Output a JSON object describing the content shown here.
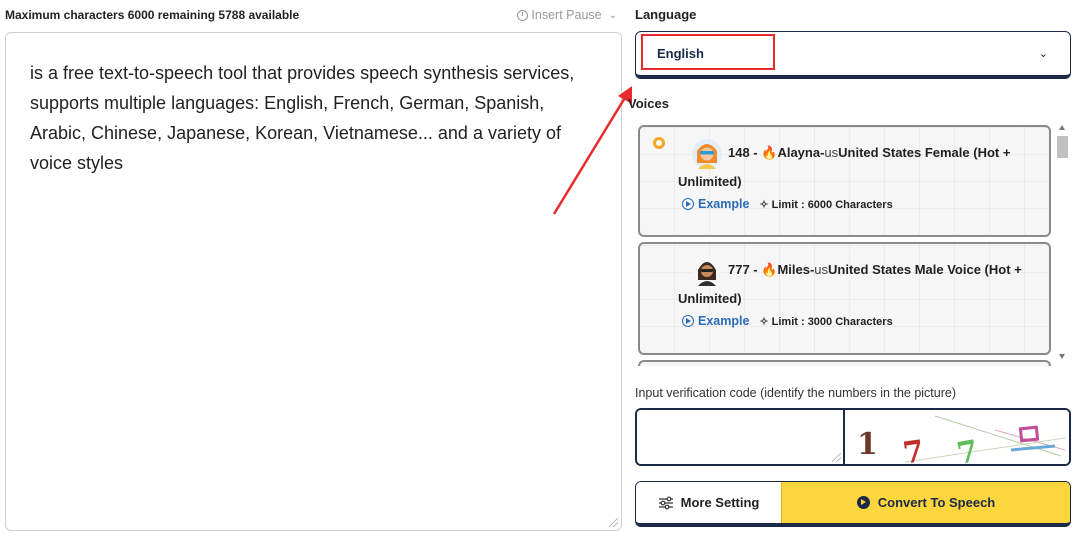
{
  "editor": {
    "char_info": "Maximum characters 6000 remaining 5788 available",
    "insert_pause_label": "Insert Pause",
    "text": "is a free text-to-speech tool that provides speech synthesis services, supports multiple languages: English, French, German, Spanish, Arabic, Chinese, Japanese, Korean, Vietnamese... and a variety of voice styles"
  },
  "language": {
    "label": "Language",
    "selected": "English"
  },
  "voices": {
    "label": "Voices",
    "items": [
      {
        "number": "148 - ",
        "name": "Alayna-",
        "locale": "us",
        "desc": "United States Female (Hot +",
        "desc2": "Unlimited)",
        "example_label": "Example",
        "limit": "Limit : 6000 Characters",
        "selected": true
      },
      {
        "number": "777 - ",
        "name": "Miles-",
        "locale": "us",
        "desc": "United States Male Voice (Hot +",
        "desc2": "Unlimited)",
        "example_label": "Example",
        "limit": "Limit : 3000 Characters",
        "selected": false
      }
    ]
  },
  "captcha": {
    "label": "Input verification code (identify the numbers in the picture)",
    "input_value": "",
    "image_text": "177"
  },
  "actions": {
    "more_setting_label": "More Setting",
    "convert_label": "Convert To Speech"
  },
  "colors": {
    "navy": "#1a2a48",
    "accent_yellow": "#fdd53c",
    "link_blue": "#2a6bb8",
    "annotation_red": "#ea2b2b"
  }
}
